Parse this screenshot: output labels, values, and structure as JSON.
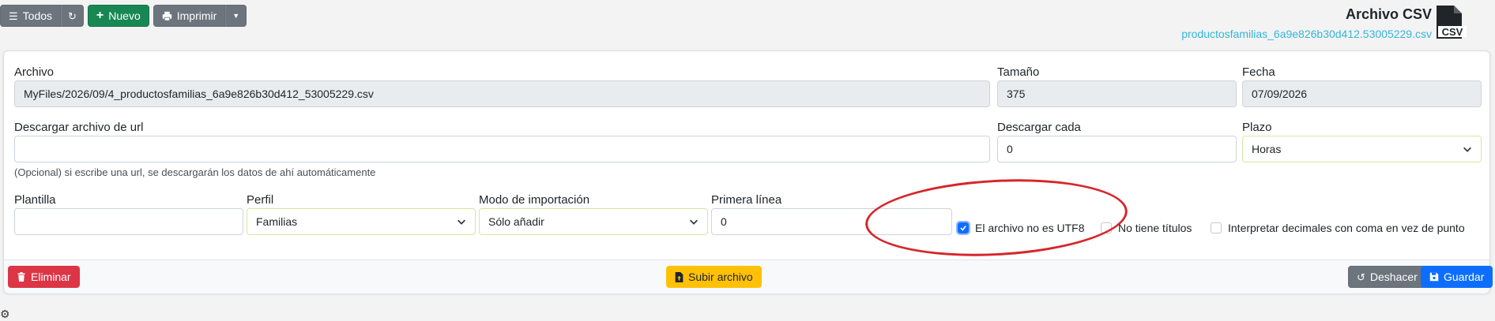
{
  "toolbar": {
    "todos_label": "Todos",
    "nuevo_label": "Nuevo",
    "imprimir_label": "Imprimir"
  },
  "header": {
    "title": "Archivo CSV",
    "filename": "productosfamilias_6a9e826b30d412.53005229.csv",
    "csv_icon_text": "CSV"
  },
  "form": {
    "archivo": {
      "label": "Archivo",
      "value": "MyFiles/2026/09/4_productosfamilias_6a9e826b30d412_53005229.csv"
    },
    "tamano": {
      "label": "Tamaño",
      "value": "375"
    },
    "fecha": {
      "label": "Fecha",
      "value": "07/09/2026"
    },
    "url": {
      "label": "Descargar archivo de url",
      "value": "",
      "help": "(Opcional) si escribe una url, se descargarán los datos de ahí automáticamente"
    },
    "descargar_cada": {
      "label": "Descargar cada",
      "value": "0"
    },
    "plazo": {
      "label": "Plazo",
      "value": "Horas"
    },
    "plantilla": {
      "label": "Plantilla",
      "value": ""
    },
    "perfil": {
      "label": "Perfil",
      "value": "Familias"
    },
    "modo": {
      "label": "Modo de importación",
      "value": "Sólo añadir"
    },
    "primera_linea": {
      "label": "Primera línea",
      "value": "0"
    },
    "checkboxes": {
      "no_utf8": {
        "label": "El archivo no es UTF8",
        "checked": true
      },
      "no_titulos": {
        "label": "No tiene títulos",
        "checked": false
      },
      "decimales_coma": {
        "label": "Interpretar decimales con coma en vez de punto",
        "checked": false
      }
    }
  },
  "footer": {
    "eliminar_label": "Eliminar",
    "subir_label": "Subir archivo",
    "deshacer_label": "Deshacer",
    "guardar_label": "Guardar"
  },
  "colors": {
    "secondary": "#6c757d",
    "success": "#198754",
    "danger": "#dc3545",
    "warning": "#ffc107",
    "primary": "#0d6efd",
    "link": "#35b6d6",
    "annotation": "#d6262a"
  }
}
